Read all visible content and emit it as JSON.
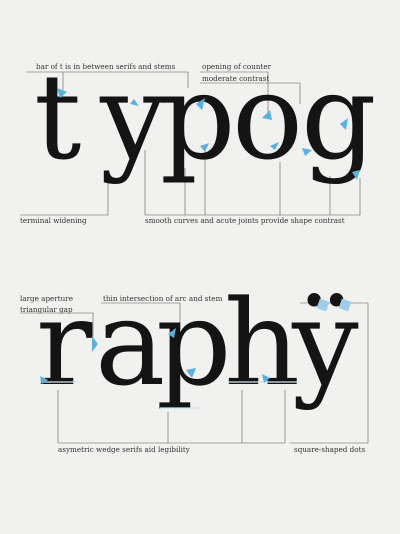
{
  "word1": {
    "letters": [
      "t",
      "y",
      "p",
      "o",
      "g"
    ]
  },
  "word2": {
    "letters": [
      "r",
      "a",
      "p",
      "h",
      "ÿ"
    ]
  },
  "annotations": {
    "bar_of_t": "bar of t is in between serifs and stems",
    "opening_of_counter": "opening of counter",
    "moderate_contrast": "moderate contrast",
    "terminal_widening": "terminal widening",
    "smooth_curves": "smooth curves and acute joints provide shape contrast",
    "large_aperture": "large aperture",
    "triangular_gap": "triangular gap",
    "thin_intersection": "thin intersection of arc and stem",
    "asymetric_wedge": "asymetric wedge serifs aid legibility",
    "square_dots": "square-shaped dots"
  },
  "colors": {
    "ink": "#141414",
    "accent": "#5ab1e0",
    "background": "#f1f1f0"
  }
}
